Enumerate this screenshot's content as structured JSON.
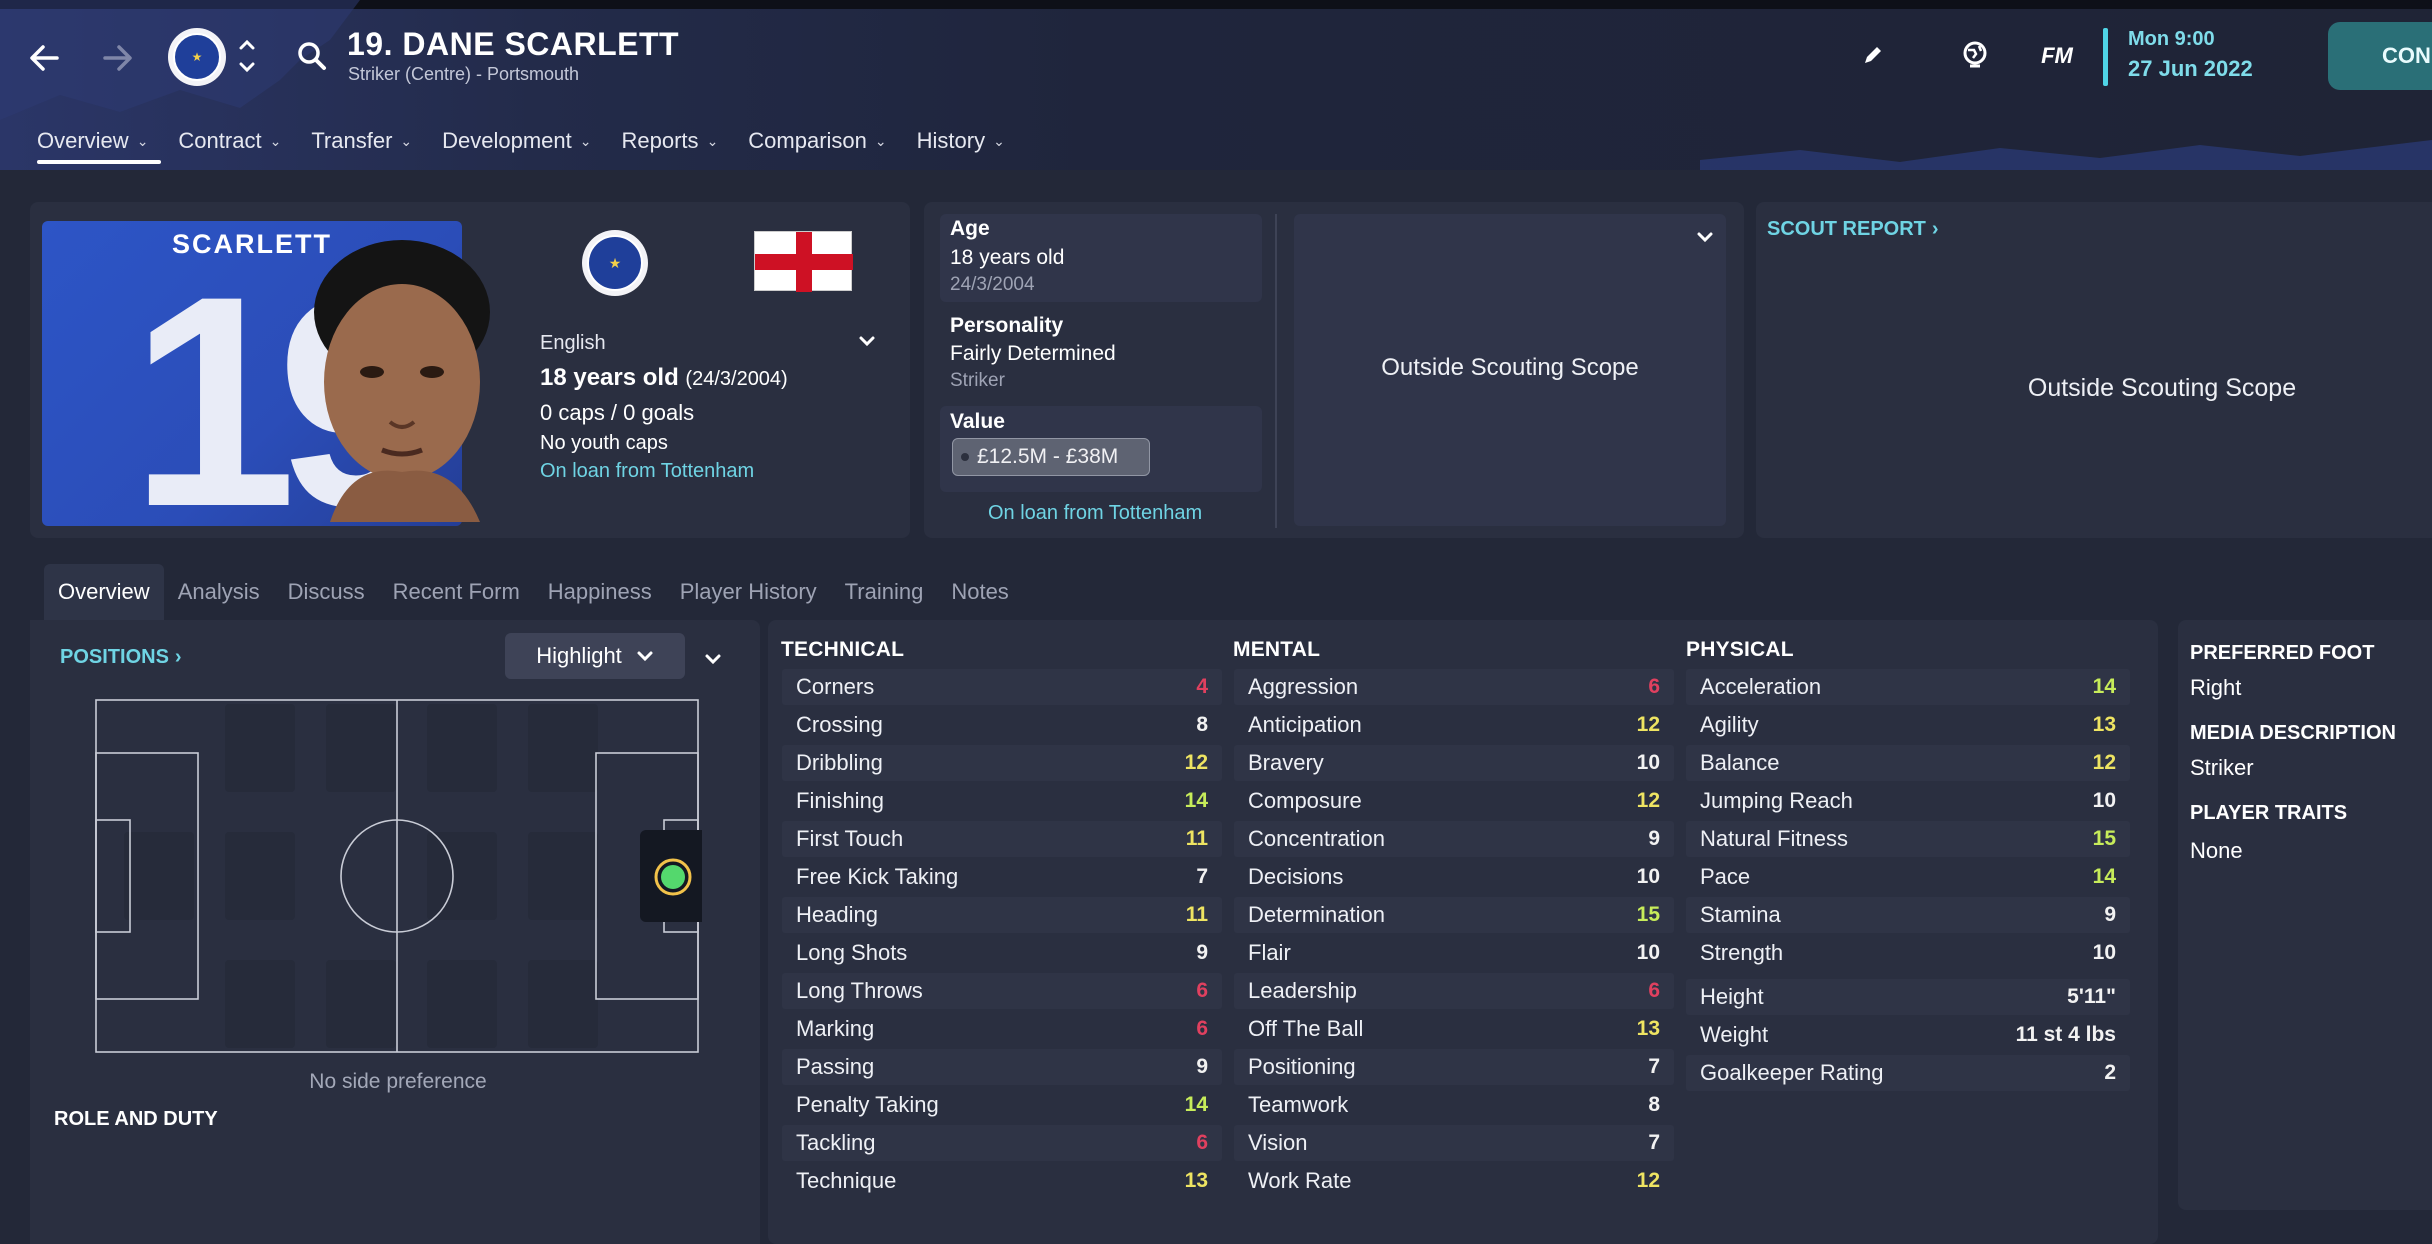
{
  "header": {
    "player_title": "19. DANE SCARLETT",
    "player_subtitle": "Striker (Centre) - Portsmouth",
    "fm_label": "FM",
    "date_line1": "Mon 9:00",
    "date_line2": "27 Jun 2022",
    "continue_label": "CON"
  },
  "nav": {
    "tabs": [
      {
        "label": "Overview"
      },
      {
        "label": "Contract"
      },
      {
        "label": "Transfer"
      },
      {
        "label": "Development"
      },
      {
        "label": "Reports"
      },
      {
        "label": "Comparison"
      },
      {
        "label": "History"
      }
    ]
  },
  "profile": {
    "shirt_name": "SCARLETT",
    "shirt_number": "19",
    "nationality": "English",
    "age_text": "18 years old",
    "dob_paren": "(24/3/2004)",
    "caps": "0 caps / 0 goals",
    "youth_caps": "No youth caps",
    "loan": "On loan from Tottenham"
  },
  "details": {
    "age_label": "Age",
    "age_value": "18 years old",
    "dob": "24/3/2004",
    "personality_label": "Personality",
    "personality_value": "Fairly Determined",
    "personality_role": "Striker",
    "value_label": "Value",
    "value_range": "£12.5M - £38M",
    "loan_link": "On loan from Tottenham"
  },
  "scouting": {
    "center_text": "Outside Scouting Scope",
    "report_title": "SCOUT REPORT",
    "report_text": "Outside Scouting Scope"
  },
  "subtabs": [
    "Overview",
    "Analysis",
    "Discuss",
    "Recent Form",
    "Happiness",
    "Player History",
    "Training",
    "Notes"
  ],
  "positions": {
    "title": "POSITIONS",
    "highlight_label": "Highlight",
    "side_pref": "No side preference",
    "role_title": "ROLE AND DUTY"
  },
  "attributes": {
    "technical_title": "TECHNICAL",
    "mental_title": "MENTAL",
    "physical_title": "PHYSICAL",
    "technical": [
      {
        "name": "Corners",
        "value": "4"
      },
      {
        "name": "Crossing",
        "value": "8"
      },
      {
        "name": "Dribbling",
        "value": "12"
      },
      {
        "name": "Finishing",
        "value": "14"
      },
      {
        "name": "First Touch",
        "value": "11"
      },
      {
        "name": "Free Kick Taking",
        "value": "7"
      },
      {
        "name": "Heading",
        "value": "11"
      },
      {
        "name": "Long Shots",
        "value": "9"
      },
      {
        "name": "Long Throws",
        "value": "6"
      },
      {
        "name": "Marking",
        "value": "6"
      },
      {
        "name": "Passing",
        "value": "9"
      },
      {
        "name": "Penalty Taking",
        "value": "14"
      },
      {
        "name": "Tackling",
        "value": "6"
      },
      {
        "name": "Technique",
        "value": "13"
      }
    ],
    "mental": [
      {
        "name": "Aggression",
        "value": "6"
      },
      {
        "name": "Anticipation",
        "value": "12"
      },
      {
        "name": "Bravery",
        "value": "10"
      },
      {
        "name": "Composure",
        "value": "12"
      },
      {
        "name": "Concentration",
        "value": "9"
      },
      {
        "name": "Decisions",
        "value": "10"
      },
      {
        "name": "Determination",
        "value": "15"
      },
      {
        "name": "Flair",
        "value": "10"
      },
      {
        "name": "Leadership",
        "value": "6"
      },
      {
        "name": "Off The Ball",
        "value": "13"
      },
      {
        "name": "Positioning",
        "value": "7"
      },
      {
        "name": "Teamwork",
        "value": "8"
      },
      {
        "name": "Vision",
        "value": "7"
      },
      {
        "name": "Work Rate",
        "value": "12"
      }
    ],
    "physical": [
      {
        "name": "Acceleration",
        "value": "14"
      },
      {
        "name": "Agility",
        "value": "13"
      },
      {
        "name": "Balance",
        "value": "12"
      },
      {
        "name": "Jumping Reach",
        "value": "10"
      },
      {
        "name": "Natural Fitness",
        "value": "15"
      },
      {
        "name": "Pace",
        "value": "14"
      },
      {
        "name": "Stamina",
        "value": "9"
      },
      {
        "name": "Strength",
        "value": "10"
      }
    ],
    "extra": [
      {
        "name": "Height",
        "value": "5'11\""
      },
      {
        "name": "Weight",
        "value": "11 st 4 lbs"
      },
      {
        "name": "Goalkeeper Rating",
        "value": "2"
      }
    ]
  },
  "side_info": {
    "foot_title": "PREFERRED FOOT",
    "foot_value": "Right",
    "media_title": "MEDIA DESCRIPTION",
    "media_value": "Striker",
    "traits_title": "PLAYER TRAITS",
    "traits_value": "None"
  },
  "colors": {
    "attr_low": "#e0405f",
    "attr_mid": "#f2f2f2",
    "attr_good": "#eee462",
    "attr_high": "#c7ec5a",
    "accent": "#6fd4e4"
  }
}
